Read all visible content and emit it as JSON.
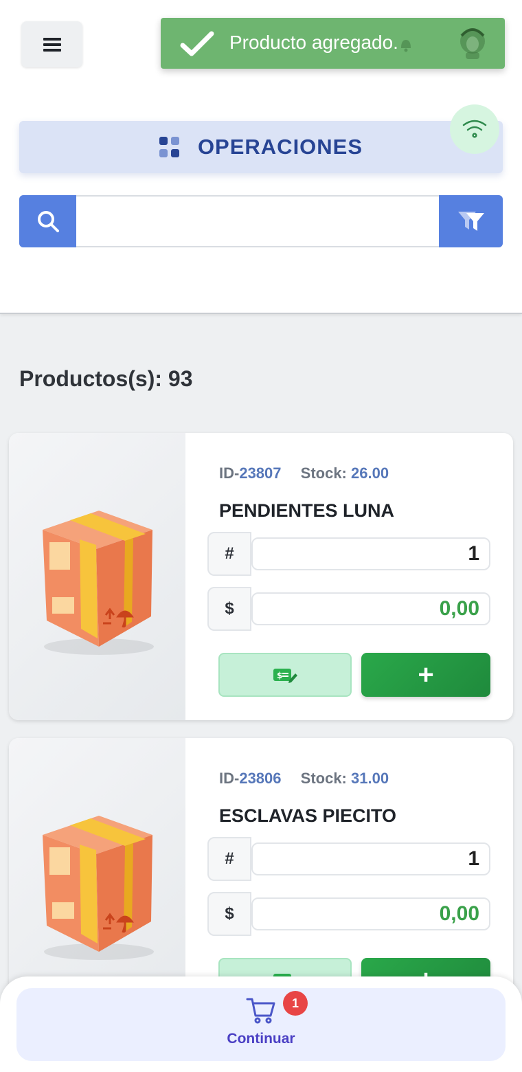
{
  "toast": {
    "message": "Producto agregado."
  },
  "header": {
    "operations_label": "OPERACIONES"
  },
  "search": {
    "value": ""
  },
  "products_count": "Productos(s): 93",
  "products": [
    {
      "id_prefix": "ID-",
      "id": "23807",
      "stock_label": "Stock: ",
      "stock": "26.00",
      "name": "PENDIENTES LUNA",
      "qty_label": "#",
      "qty": "1",
      "price_label": "$",
      "price": "0,00",
      "add_label": "+"
    },
    {
      "id_prefix": "ID-",
      "id": "23806",
      "stock_label": "Stock: ",
      "stock": "31.00",
      "name": "ESCLAVAS PIECITO",
      "qty_label": "#",
      "qty": "1",
      "price_label": "$",
      "price": "0,00",
      "add_label": "+"
    }
  ],
  "footer": {
    "cart_count": "1",
    "continue_label": "Continuar"
  },
  "colors": {
    "accent": "#5680e0",
    "success": "#3aa14a",
    "primary_dark": "#274494",
    "badge": "#e84545"
  }
}
